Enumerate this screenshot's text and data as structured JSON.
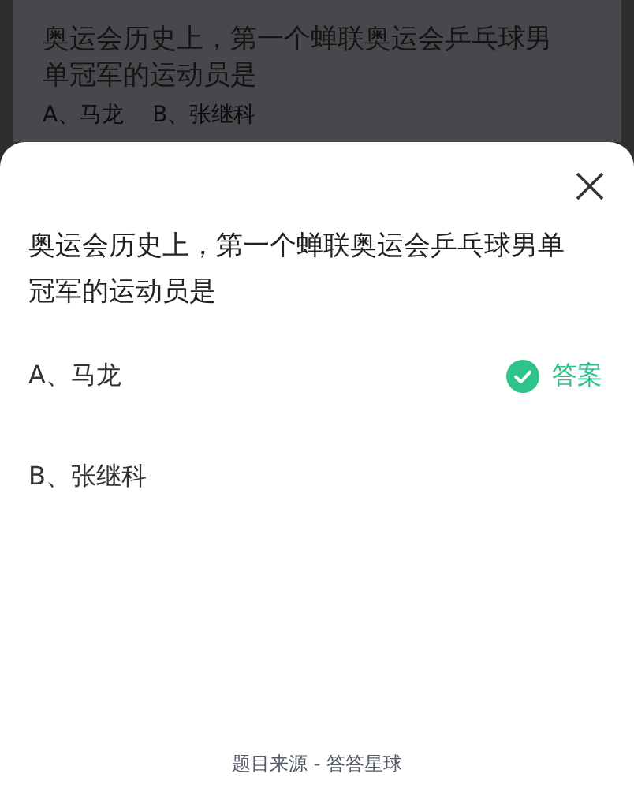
{
  "background_card": {
    "question": "奥运会历史上，第一个蝉联奥运会乒乓球男单冠军的运动员是",
    "options": [
      "A、马龙",
      "B、张继科"
    ]
  },
  "sheet": {
    "question": "奥运会历史上，第一个蝉联奥运会乒乓球男单冠军的运动员是",
    "options": [
      {
        "label": "A、马龙",
        "correct": true,
        "badge": "答案"
      },
      {
        "label": "B、张继科",
        "correct": false
      }
    ],
    "source": "题目来源 - 答答星球"
  }
}
